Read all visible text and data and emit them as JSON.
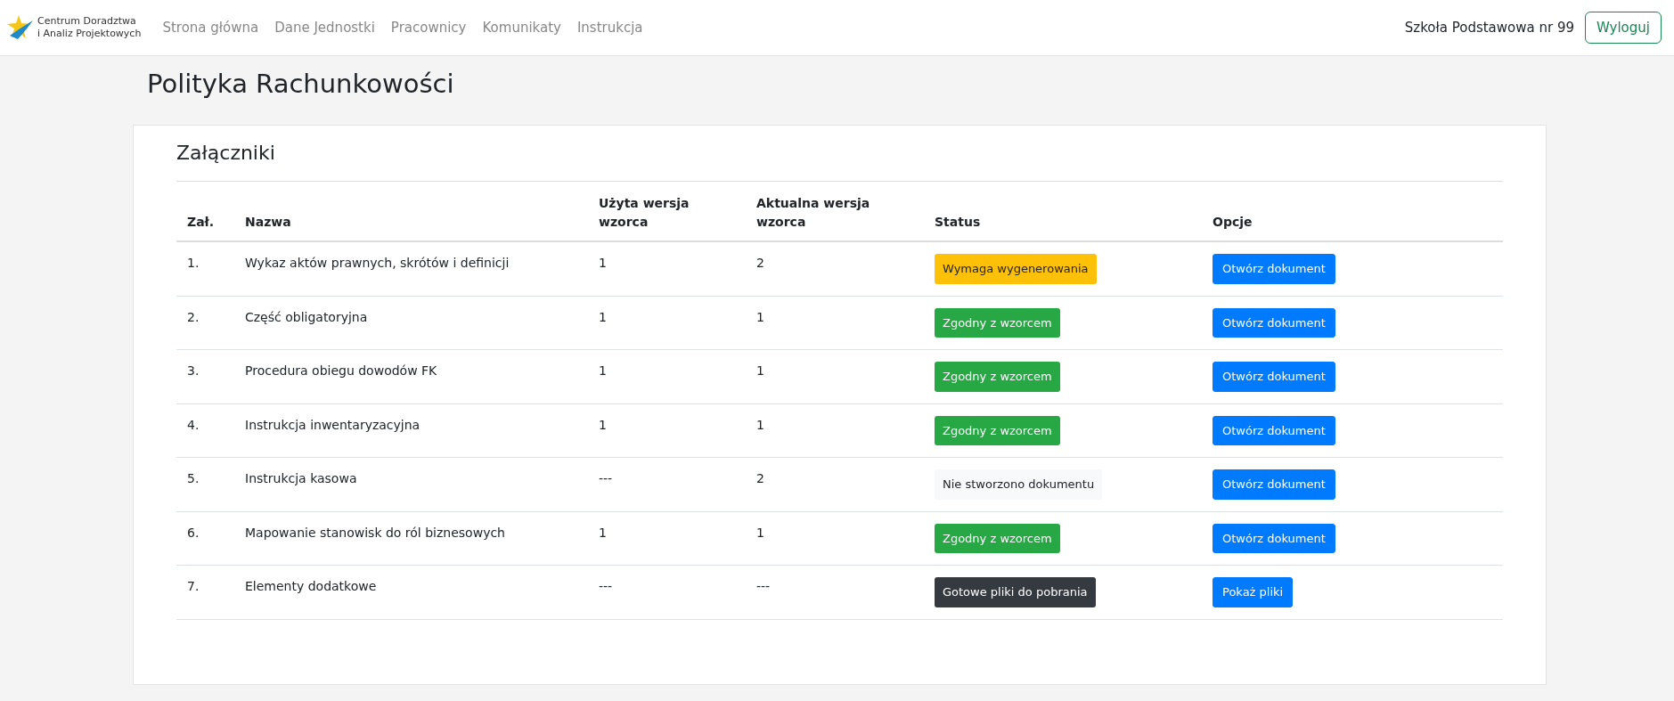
{
  "brand": {
    "line1": "Centrum Doradztwa",
    "line2": "i Analiz Projektowych"
  },
  "nav": [
    "Strona główna",
    "Dane Jednostki",
    "Pracownicy",
    "Komunikaty",
    "Instrukcja"
  ],
  "user": "Szkoła Podstawowa nr 99",
  "logout": "Wyloguj",
  "page_title": "Polityka Rachunkowości",
  "section_title": "Załączniki",
  "table": {
    "columns": [
      "Zał.",
      "Nazwa",
      "Użyta wersja wzorca",
      "Aktualna wersja wzorca",
      "Status",
      "Opcje"
    ],
    "rows": [
      {
        "no": "1.",
        "name": "Wykaz aktów prawnych, skrótów i definicji",
        "used": "1",
        "current": "2",
        "status": "Wymaga wygenerowania",
        "color": "#ffc107",
        "action": "Otwórz dokument"
      },
      {
        "no": "2.",
        "name": "Część obligatoryjna",
        "used": "1",
        "current": "1",
        "status": "Zgodny z wzorcem",
        "color": "#28a745",
        "action": "Otwórz dokument"
      },
      {
        "no": "3.",
        "name": "Procedura obiegu dowodów FK",
        "used": "1",
        "current": "1",
        "status": "Zgodny z wzorcem",
        "color": "#28a745",
        "action": "Otwórz dokument"
      },
      {
        "no": "4.",
        "name": "Instrukcja inwentaryzacyjna",
        "used": "1",
        "current": "1",
        "status": "Zgodny z wzorcem",
        "color": "#28a745",
        "action": "Otwórz dokument"
      },
      {
        "no": "5.",
        "name": "Instrukcja kasowa",
        "used": "---",
        "current": "2",
        "status": "Nie stworzono dokumentu",
        "color": "#f8f9fa",
        "action": "Otwórz dokument"
      },
      {
        "no": "6.",
        "name": "Mapowanie stanowisk do ról biznesowych",
        "used": "1",
        "current": "1",
        "status": "Zgodny z wzorcem",
        "color": "#28a745",
        "action": "Otwórz dokument"
      },
      {
        "no": "7.",
        "name": "Elementy dodatkowe",
        "used": "---",
        "current": "---",
        "status": "Gotowe pliki do pobrania",
        "color": "#343a40",
        "action": "Pokaż pliki"
      }
    ]
  }
}
